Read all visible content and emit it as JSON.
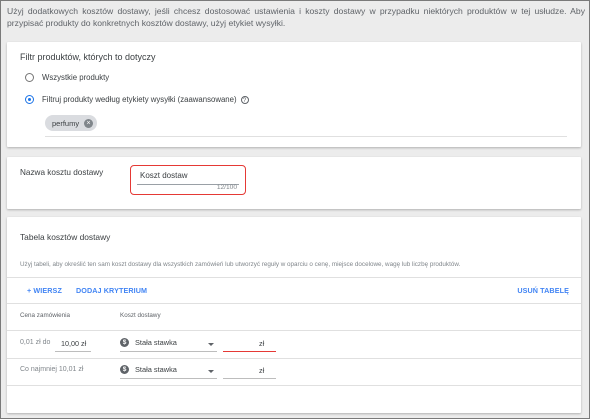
{
  "intro": {
    "text": "Użyj dodatkowych kosztów dostawy, jeśli chcesz dostosować ustawienia i koszty dostawy w przypadku niektórych produktów w tej usłudze. Aby przypisać produkty do konkretnych kosztów dostawy, użyj etykiet wysyłki."
  },
  "filter": {
    "title": "Filtr produktów, których to dotyczy",
    "options": [
      {
        "label": "Wszystkie produkty",
        "checked": false
      },
      {
        "label": "Filtruj produkty według etykiety wysyłki (zaawansowane)",
        "checked": true
      }
    ],
    "help_icon": "?",
    "chip_label": "perfumy",
    "chip_remove": "×"
  },
  "cost_name": {
    "label": "Nazwa kosztu dostawy",
    "value": "Koszt dostaw",
    "counter": "12/100",
    "highlight_color": "#e53935"
  },
  "table": {
    "title": "Tabela kosztów dostawy",
    "description": "Użyj tabeli, aby określić ten sam koszt dostawy dla wszystkich zamówień lub utworzyć reguły w oparciu o cenę, miejsce docelowe, wagę lub liczbę produktów.",
    "buttons": {
      "add_row": "+ WIERSZ",
      "add_criterion": "DODAJ KRYTERIUM",
      "remove_table": "USUŃ TABELĘ"
    },
    "columns": [
      "Cena zamówienia",
      "Koszt dostawy"
    ],
    "rows": [
      {
        "price_prefix": "0,01 zł do",
        "price_value": "10,00 zł",
        "rate_icon": "dollar-icon",
        "rate_type": "Stała stawka",
        "cost_unit": "zł",
        "cost_error": true
      },
      {
        "price_prefix": "Co najmniej 10,01 zł",
        "price_value": "",
        "rate_icon": "dollar-icon",
        "rate_type": "Stała stawka",
        "cost_unit": "zł",
        "cost_error": false
      }
    ],
    "accent_color": "#4285f4"
  }
}
